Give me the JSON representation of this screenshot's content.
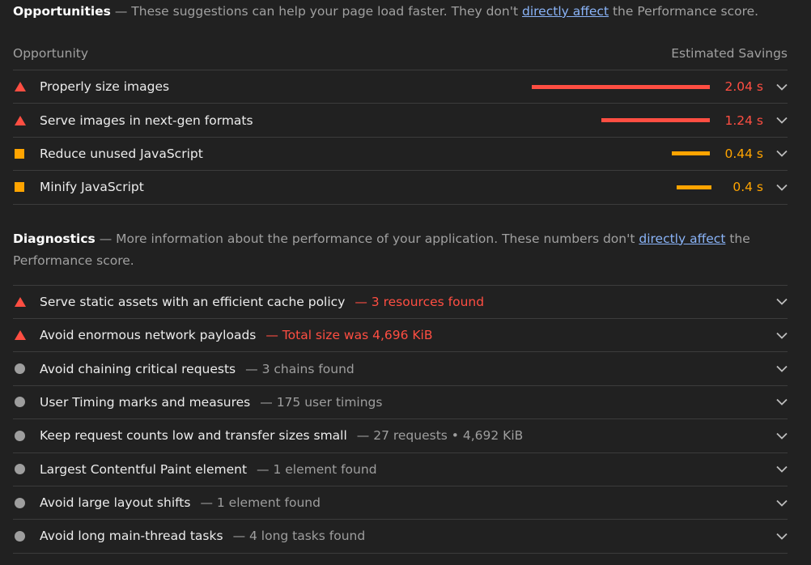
{
  "opportunities": {
    "title": "Opportunities",
    "desc_before": " — These suggestions can help your page load faster. They don't ",
    "link": "directly affect",
    "desc_after": " the Performance score.",
    "col_left": "Opportunity",
    "col_right": "Estimated Savings",
    "items": [
      {
        "label": "Properly size images",
        "savings": "2.04 s",
        "status": "fail",
        "bar_fraction": 1.0
      },
      {
        "label": "Serve images in next-gen formats",
        "savings": "1.24 s",
        "status": "fail",
        "bar_fraction": 0.61
      },
      {
        "label": "Reduce unused JavaScript",
        "savings": "0.44 s",
        "status": "average",
        "bar_fraction": 0.215
      },
      {
        "label": "Minify JavaScript",
        "savings": "0.4 s",
        "status": "average",
        "bar_fraction": 0.196
      }
    ]
  },
  "diagnostics": {
    "title": "Diagnostics",
    "desc_before": " — More information about the performance of your application. These numbers don't ",
    "link": "directly affect",
    "desc_after": " the Performance score.",
    "items": [
      {
        "label": "Serve static assets with an efficient cache policy",
        "detail": "— 3 resources found",
        "status": "fail"
      },
      {
        "label": "Avoid enormous network payloads",
        "detail": "— Total size was 4,696 KiB",
        "status": "fail"
      },
      {
        "label": "Avoid chaining critical requests",
        "detail": "— 3 chains found",
        "status": "info"
      },
      {
        "label": "User Timing marks and measures",
        "detail": "— 175 user timings",
        "status": "info"
      },
      {
        "label": "Keep request counts low and transfer sizes small",
        "detail": "— 27 requests • 4,692 KiB",
        "status": "info"
      },
      {
        "label": "Largest Contentful Paint element",
        "detail": "— 1 element found",
        "status": "info"
      },
      {
        "label": "Avoid large layout shifts",
        "detail": "— 1 element found",
        "status": "info"
      },
      {
        "label": "Avoid long main-thread tasks",
        "detail": "— 4 long tasks found",
        "status": "info"
      }
    ]
  },
  "colors": {
    "fail": "#ff4e42",
    "average": "#ffa400",
    "info": "#9e9e9e",
    "link": "#8ab4f8"
  },
  "icons": {
    "fail": "warning-triangle-icon",
    "average": "orange-square-icon",
    "info": "gray-circle-icon",
    "expand": "chevron-down-icon"
  }
}
